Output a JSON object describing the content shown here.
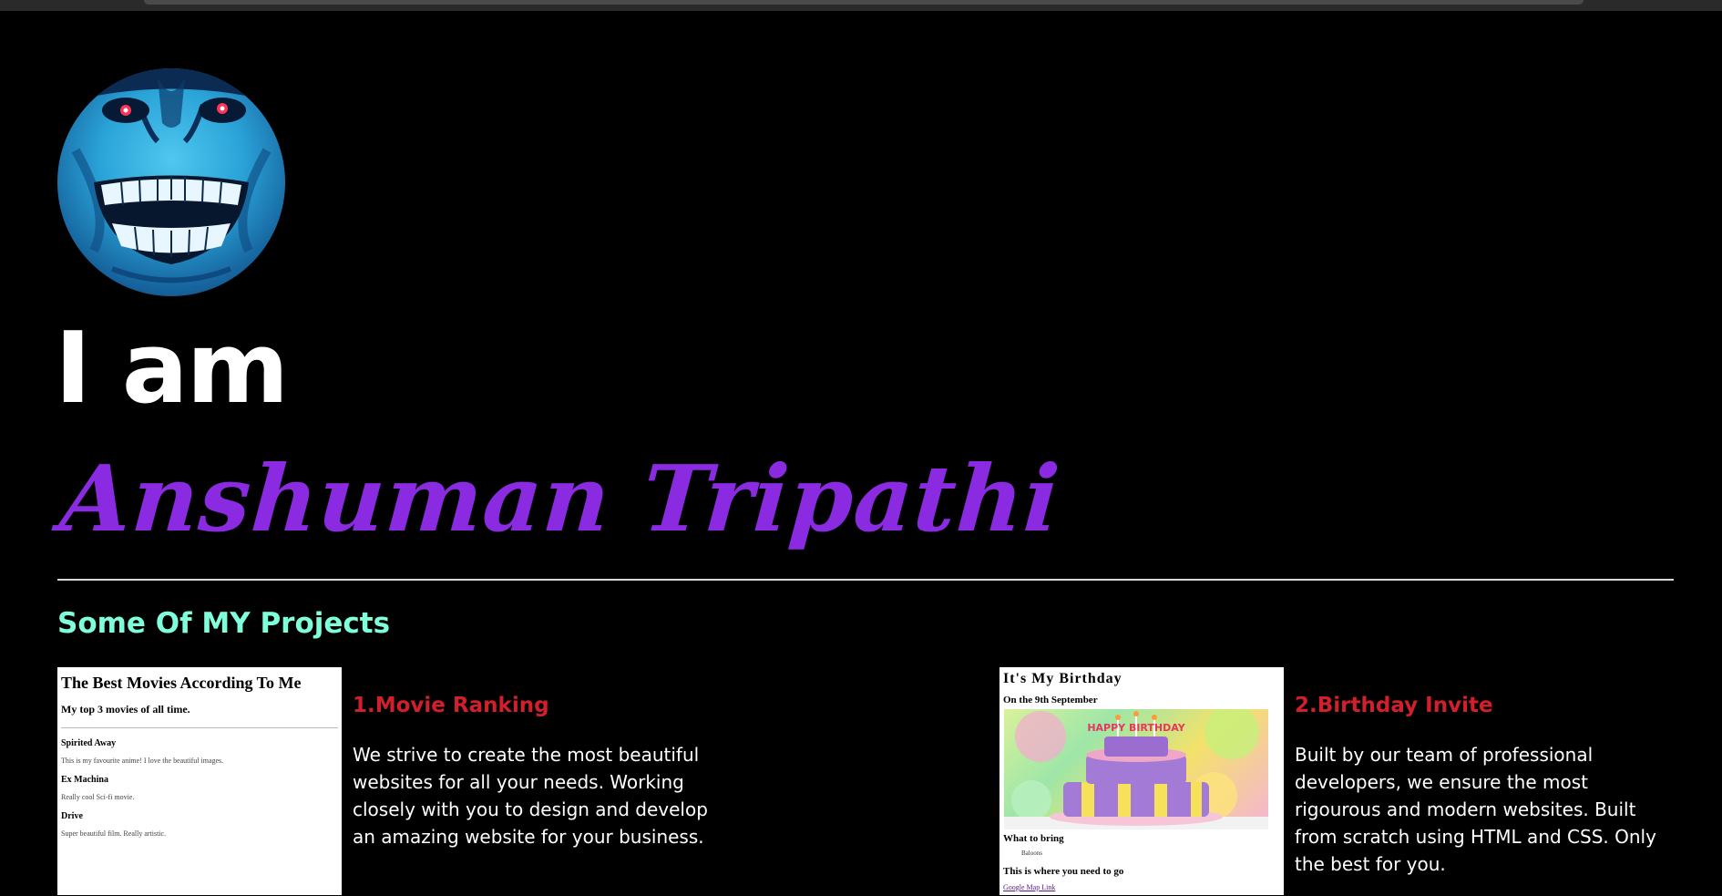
{
  "hero": {
    "greeting": "I am",
    "name": "Anshuman Tripathi"
  },
  "projects_section": {
    "title": "Some Of MY Projects"
  },
  "projects": [
    {
      "title": "1.Movie Ranking",
      "description": "We strive to create the most beautiful websites for all your needs. Working closely with you to design and develop an amazing website for your business.",
      "thumbnail": {
        "heading": "The Best Movies According To Me",
        "subheading": "My top 3 movies of all time.",
        "movies": [
          {
            "title": "Spirited Away",
            "desc": "This is my favourite anime! I love the beautiful images."
          },
          {
            "title": "Ex Machina",
            "desc": "Really cool Sci-fi movie."
          },
          {
            "title": "Drive",
            "desc": "Super beautiful film. Really artistic."
          }
        ]
      }
    },
    {
      "title": "2.Birthday Invite",
      "description": "Built by our team of professional developers, we ensure the most rigourous and modern websites. Built from scratch using HTML and CSS. Only the best for you.",
      "thumbnail": {
        "heading": "It's My Birthday",
        "subheading": "On the 9th September",
        "cake_text": "HAPPY BIRTHDAY",
        "bring_heading": "What to bring",
        "bring_item": "Baloons",
        "where_heading": "This is where you need to go",
        "map_link": "Google Map Link"
      }
    }
  ],
  "colors": {
    "background": "#000000",
    "name": "#8a2be2",
    "section_title": "#80ffdb",
    "project_title": "#d1202c",
    "text": "#ffffff"
  }
}
